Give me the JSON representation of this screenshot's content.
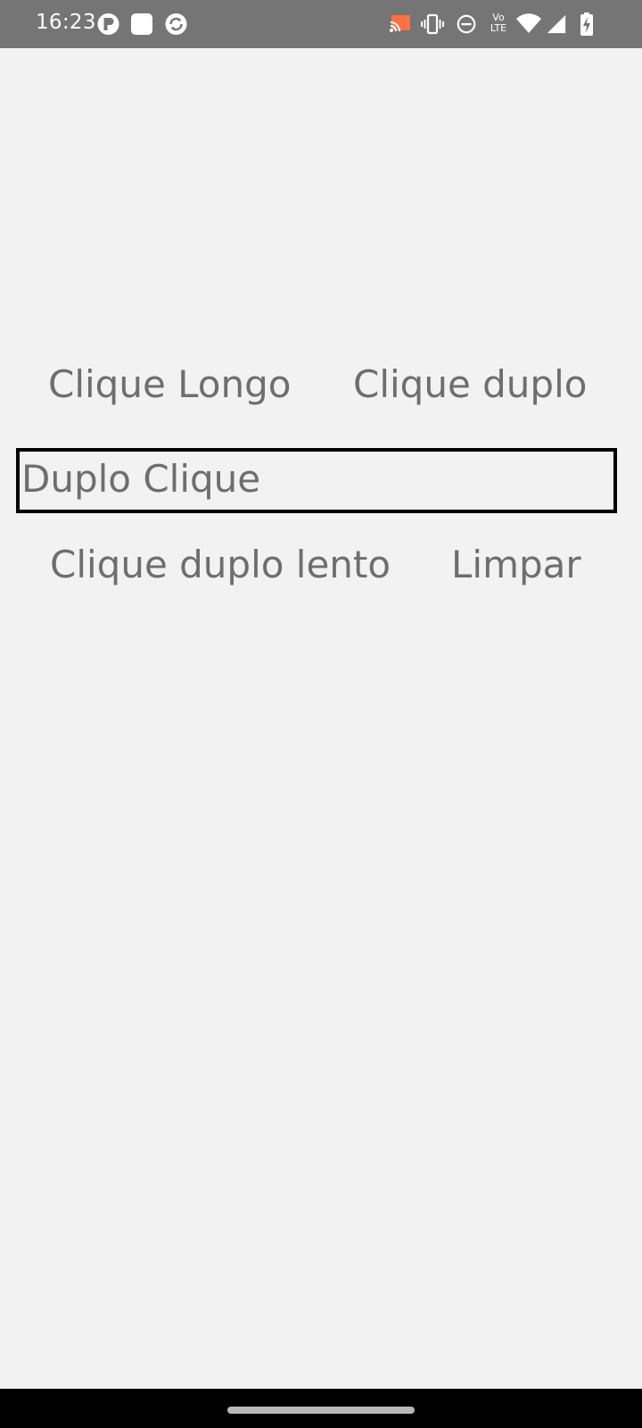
{
  "status_bar": {
    "time": "16:23",
    "left_icons": [
      "notification-app-icon",
      "square-app-icon",
      "sync-app-icon"
    ],
    "right_icons": [
      "cast-icon",
      "vibrate-icon",
      "do-not-disturb-icon",
      "volte-icon",
      "wifi-icon",
      "signal-icon",
      "battery-charging-icon"
    ],
    "volte_text_top": "Vo",
    "volte_text_bottom": "LTE",
    "cast_accent": "#ff7043"
  },
  "actions": {
    "long_click": "Clique Longo",
    "double_click": "Clique duplo",
    "slow_double_click": "Clique duplo lento",
    "clear": "Limpar"
  },
  "result": {
    "text": "Duplo Clique"
  },
  "colors": {
    "background": "#f2f2f2",
    "text": "#6e6e6e",
    "status_bar": "#757575",
    "result_border": "#000000"
  }
}
